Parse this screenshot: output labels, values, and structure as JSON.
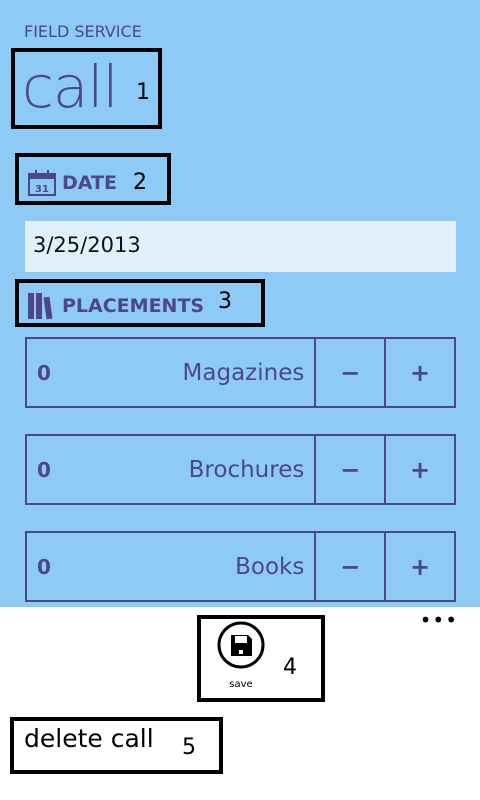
{
  "app_title": "FIELD SERVICE",
  "page_title": "call",
  "date": {
    "label": "DATE",
    "icon": "calendar-icon",
    "icon_day": "31",
    "value": "3/25/2013"
  },
  "placements": {
    "label": "PLACEMENTS",
    "icon": "books-icon",
    "items": [
      {
        "count": "0",
        "label": "Magazines"
      },
      {
        "count": "0",
        "label": "Brochures"
      },
      {
        "count": "0",
        "label": "Books"
      }
    ],
    "minus": "−",
    "plus": "+"
  },
  "appbar": {
    "save_label": "save",
    "more": "•••",
    "menu_delete": "delete call"
  },
  "annotations": [
    "1",
    "2",
    "3",
    "4",
    "5"
  ],
  "colors": {
    "background": "#8ECAF6",
    "accent": "#4E4785",
    "input": "#E1F1FC"
  }
}
